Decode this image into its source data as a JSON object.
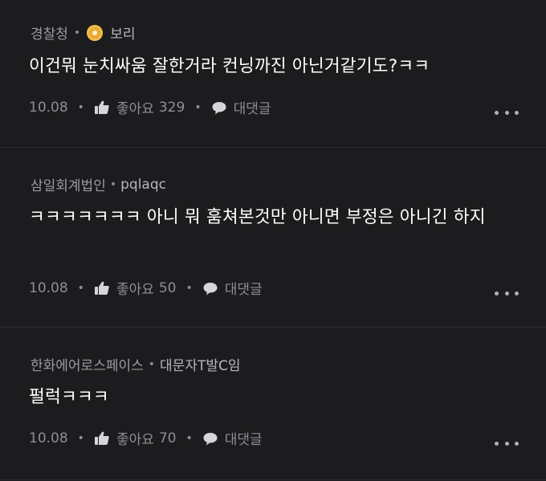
{
  "comments": [
    {
      "company": "경찰청",
      "author": "보리",
      "text": "이건뭐 눈치싸움 잘한거라 컨닝까진 아닌거같기도?ㅋㅋ",
      "date": "10.08",
      "like_label": "좋아요",
      "like_count": "329",
      "reply_label": "대댓글",
      "has_badge": true
    },
    {
      "company": "삼일회계법인",
      "author": "pqlaqc",
      "text": "ㅋㅋㅋㅋㅋㅋㅋ 아니 뭐 훔쳐본것만 아니면 부정은 아니긴 하지",
      "date": "10.08",
      "like_label": "좋아요",
      "like_count": "50",
      "reply_label": "대댓글",
      "has_badge": false
    },
    {
      "company": "한화에어로스페이스",
      "author": "대문자T발C임",
      "text": "펄럭ㅋㅋㅋ",
      "date": "10.08",
      "like_label": "좋아요",
      "like_count": "70",
      "reply_label": "대댓글",
      "has_badge": false
    }
  ],
  "icons": {
    "badge": "gold-coin-badge-icon",
    "like": "thumbs-up-icon",
    "reply": "speech-bubble-icon",
    "more": "more-options-icon"
  },
  "colors": {
    "background": "#1c1c1e",
    "meta_text": "#9b9ba0",
    "body_text": "#ffffff",
    "badge_gold": "#e8a93a"
  }
}
